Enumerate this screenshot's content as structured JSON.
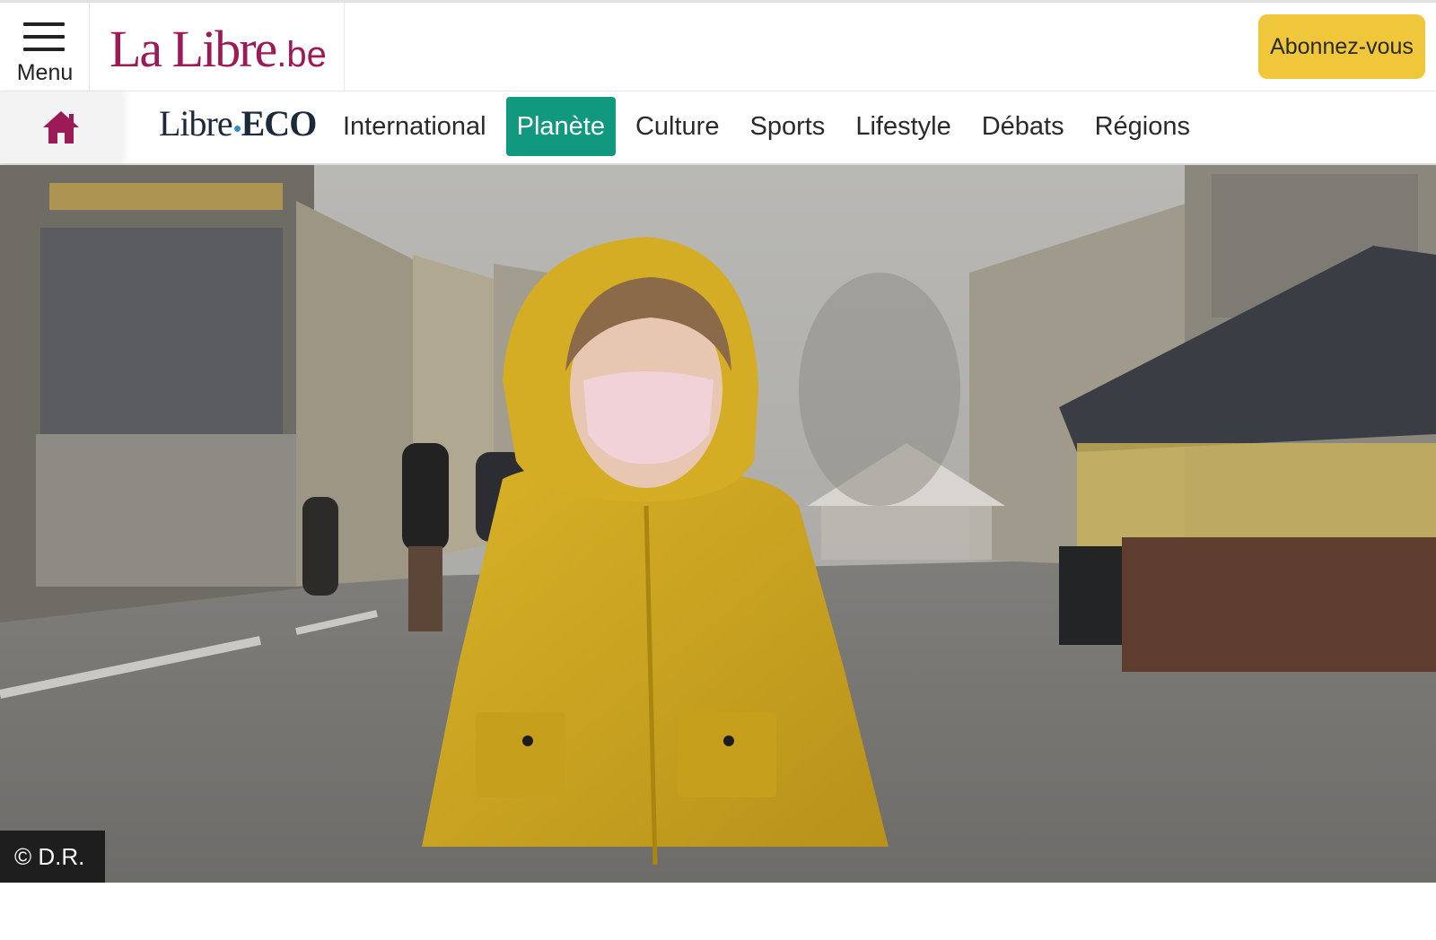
{
  "header": {
    "menu_label": "Menu",
    "logo_main": "La Libre",
    "logo_tld": ".be",
    "subscribe_label": "Abonnez-vous"
  },
  "nav": {
    "home_icon": "home-icon",
    "eco_logo_part1": "Libre",
    "eco_logo_part2": "ECO",
    "items": [
      {
        "label": "International",
        "active": false
      },
      {
        "label": "Planète",
        "active": true
      },
      {
        "label": "Culture",
        "active": false
      },
      {
        "label": "Sports",
        "active": false
      },
      {
        "label": "Lifestyle",
        "active": false
      },
      {
        "label": "Débats",
        "active": false
      },
      {
        "label": "Régions",
        "active": false
      }
    ]
  },
  "hero": {
    "credit": "© D.R."
  },
  "colors": {
    "brand": "#9c1a56",
    "subscribe": "#f0c63a",
    "active_section": "#119980"
  }
}
